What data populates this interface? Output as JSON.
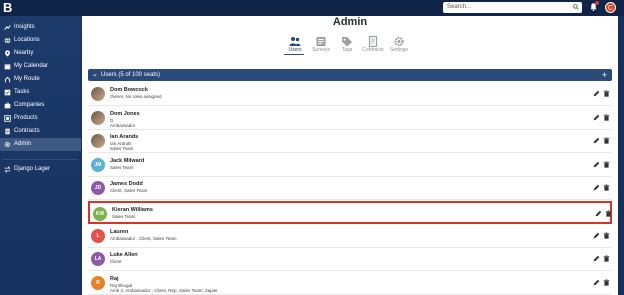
{
  "app": {
    "logo": "B"
  },
  "header": {
    "search_placeholder": "Search...",
    "avatar_initial": "C"
  },
  "sidebar": {
    "items": [
      {
        "label": "Insights",
        "icon": "insights-icon"
      },
      {
        "label": "Locations",
        "icon": "globe-icon"
      },
      {
        "label": "Nearby",
        "icon": "location-pin-icon"
      },
      {
        "label": "My Calendar",
        "icon": "calendar-icon"
      },
      {
        "label": "My Route",
        "icon": "route-icon"
      },
      {
        "label": "Tasks",
        "icon": "tasks-icon"
      },
      {
        "label": "Companies",
        "icon": "briefcase-icon"
      },
      {
        "label": "Products",
        "icon": "products-icon"
      },
      {
        "label": "Contracts",
        "icon": "contract-icon"
      },
      {
        "label": "Admin",
        "icon": "gear-icon",
        "active": true
      }
    ],
    "switch_user": {
      "label": "Django Lager",
      "icon": "switch-icon"
    }
  },
  "main": {
    "title": "Admin",
    "tabs": [
      {
        "label": "Users",
        "icon": "users-icon",
        "active": true
      },
      {
        "label": "Surveys",
        "icon": "survey-icon"
      },
      {
        "label": "Tags",
        "icon": "tag-icon"
      },
      {
        "label": "Contracts",
        "icon": "contract-icon"
      },
      {
        "label": "Settings",
        "icon": "gear-icon"
      }
    ],
    "users_section": {
      "title": "Users (5 of 100 seats)",
      "rows": [
        {
          "initials": "",
          "name": "Dom Bowcock",
          "line1": "Owner, No roles assigned",
          "line2": "",
          "avatar_color": "#7a7a7a",
          "photo": true
        },
        {
          "initials": "",
          "name": "Dom Jones",
          "line1": "D",
          "line2": "Ambassador",
          "avatar_color": "#c65a2a",
          "photo": true
        },
        {
          "initials": "",
          "name": "Ian Arands",
          "line1": "Ian Arands",
          "line2": "Sales Team",
          "avatar_color": "#6b6b6b",
          "photo": true
        },
        {
          "initials": "JM",
          "name": "Jack Milward",
          "line1": "Sales Team",
          "line2": "",
          "avatar_color": "#5bb0d9",
          "photo": false
        },
        {
          "initials": "JD",
          "name": "James Dodd",
          "line1": "Client, Sales Team",
          "line2": "",
          "avatar_color": "#8e5aa8",
          "photo": false
        },
        {
          "initials": "KW",
          "name": "Kieran Williams",
          "line1": "Sales Team",
          "line2": "",
          "avatar_color": "#7cb24a",
          "photo": false,
          "highlight": true
        },
        {
          "initials": "L",
          "name": "Lauren",
          "line1": "Ambassador , Client, Sales Team",
          "line2": "",
          "avatar_color": "#e0524a",
          "photo": false
        },
        {
          "initials": "LA",
          "name": "Luke Allen",
          "line1": "Client",
          "line2": "",
          "avatar_color": "#8e5aa8",
          "photo": false
        },
        {
          "initials": "R",
          "name": "Raj",
          "line1": "Raj Bhogal",
          "line2": "Amb 2, Ambassador , Client, Rep, Sales Team, Zapier",
          "avatar_color": "#e8822a",
          "photo": false
        }
      ]
    }
  },
  "colors": {
    "sidebar": "#1c3a6a",
    "topbar": "#0f2447",
    "accent": "#2a4a7a",
    "highlight_border": "#d9322b"
  }
}
